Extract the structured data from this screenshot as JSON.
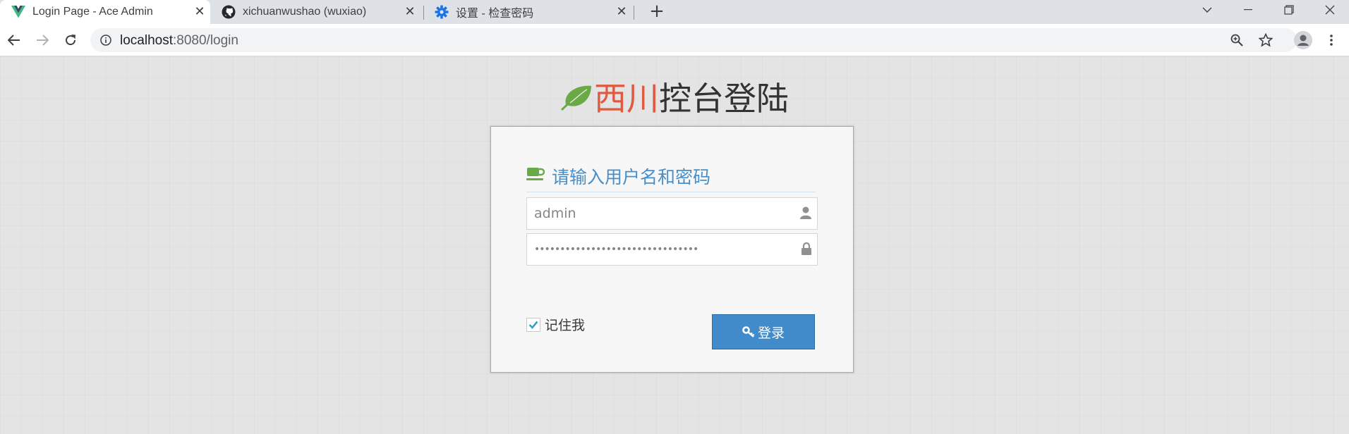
{
  "browser": {
    "tabs": [
      {
        "title": "Login Page - Ace Admin",
        "icon": "vue-logo-icon",
        "active": true
      },
      {
        "title": "xichuanwushao (wuxiao)",
        "icon": "github-icon",
        "active": false
      },
      {
        "title": "设置 - 检查密码",
        "icon": "gear-icon",
        "active": false
      }
    ],
    "new_tab": "+",
    "address": {
      "host": "localhost",
      "path": ":8080/login"
    }
  },
  "page": {
    "brand": {
      "red": "西川",
      "dark": "控台登陆",
      "icon": "leaf-icon",
      "colors": {
        "red": "#dd5a43",
        "leaf": "#69aa46"
      }
    },
    "login": {
      "title": "请输入用户名和密码",
      "title_icon": "coffee-icon",
      "username": {
        "value": "admin",
        "icon": "user-icon"
      },
      "password": {
        "value": "••••••••••••••••••••••••••••••••",
        "icon": "lock-icon"
      },
      "remember": {
        "label": "记住我",
        "checked": true
      },
      "submit": {
        "label": "登录",
        "icon": "key-icon",
        "color": "#428bca"
      }
    }
  }
}
